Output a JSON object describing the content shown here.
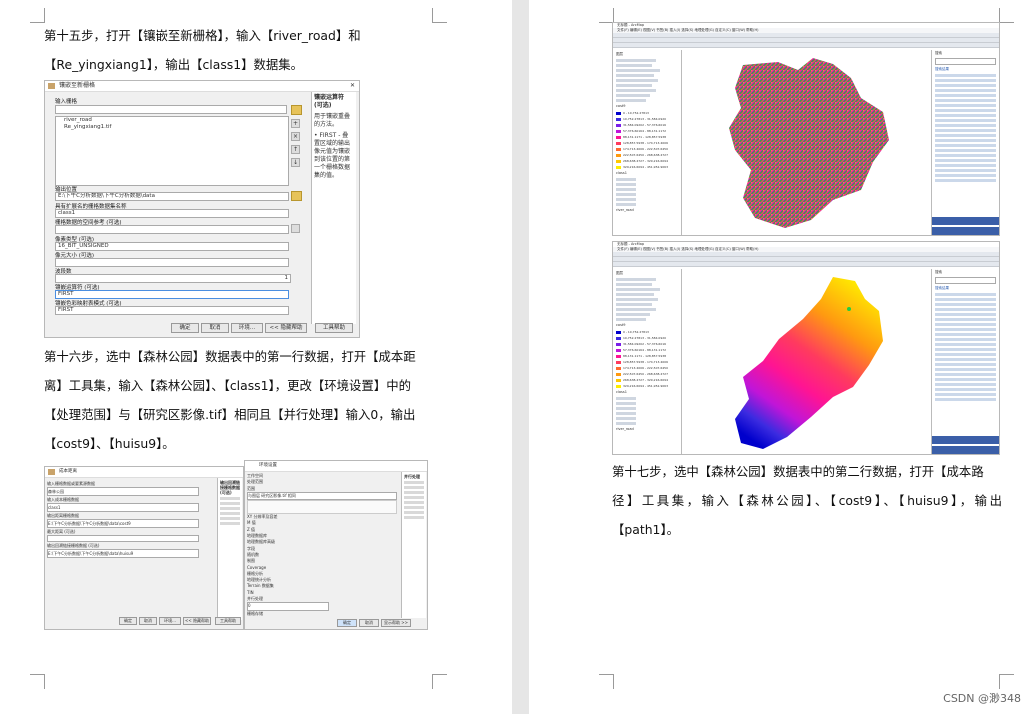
{
  "left_page": {
    "para1": [
      "第十五步，打开【镶嵌至新栅格】，输入【river_road】和",
      "【Re_yingxiang1】，输出【class1】数据集。"
    ],
    "dialog1": {
      "title": "镶嵌至新栅格",
      "input_label": "输入栅格",
      "inputs": [
        "river_road",
        "Re_yingxiang1.tif"
      ],
      "output_loc_label": "输出位置",
      "output_loc_value": "E:\\下午C分析数据\\下午C分析数据\\data",
      "name_label": "具有扩展名的栅格数据集名称",
      "name_value": "class1",
      "sr_label": "栅格数据的空间参考 (可选)",
      "pixel_label": "像素类型 (可选)",
      "pixel_value": "16_BIT_UNSIGNED",
      "cell_label": "像元大小 (可选)",
      "bands_label": "波段数",
      "bands_value": "1",
      "mosaic_label": "镶嵌运算符 (可选)",
      "mosaic_value": "FIRST",
      "colormap_label": "镶嵌色彩映射表模式 (可选)",
      "colormap_value": "FIRST",
      "help_title": "镶嵌运算符 (可选)",
      "help_text": "用于镶嵌重叠的方法。",
      "help_bullet": "• FIRST - 叠置区域的输出像元值为镶嵌到该位置的第一个栅格数据集的值。",
      "buttons": [
        "确定",
        "取消",
        "环境...",
        "<< 隐藏帮助",
        "工具帮助"
      ]
    },
    "para2": [
      "第十六步，选中【森林公园】数据表中的第一行数据，打开【成本距",
      "离】工具集，输入【森林公园】、【class1】，更改【环境设置】中的",
      "【处理范围】与【研究区影像.tif】相同且【并行处理】输入0，输出",
      "【cost9】、【huisu9】。"
    ],
    "dialog2": {
      "title": "成本距离",
      "labels": [
        "输入栅格数据或要素源数据",
        "森林公园",
        "输入成本栅格数据",
        "class1",
        "输出距离栅格数据",
        "E:\\下午C分析数据\\下午C分析数据\\data\\cost9",
        "最大距离 (可选)",
        "输出回溯链接栅格数据 (可选)",
        "E:\\下午C分析数据\\下午C分析数据\\data\\huisu9"
      ],
      "help_title": "输出回溯链接栅格数据 (可选)",
      "buttons": [
        "确定",
        "取消",
        "环境...",
        "<< 隐藏帮助",
        "工具帮助"
      ]
    },
    "dialog3": {
      "title": "环境设置",
      "section_workspace": "工作空间",
      "section_extent": "处理范围",
      "extent_label": "范围",
      "extent_value": "与图层 研究区影像.tif 相同",
      "items": [
        "XY 分辨率及容差",
        "M 值",
        "Z 值",
        "地理数据库",
        "地理数据库高级",
        "字段",
        "随机数",
        "制图",
        "Coverage",
        "栅格分析",
        "地理统计分析",
        "Terrain 数据集",
        "TIN",
        "并行处理",
        "并行处理因子",
        "栅格存储",
        "地理配准"
      ],
      "parallel_value": "0",
      "help_title": "并行处理",
      "buttons": [
        "确定",
        "取消",
        "显示帮助 >>"
      ]
    }
  },
  "right_page": {
    "app_title": "无标题 - ArcMap",
    "menu": [
      "文件(F)",
      "编辑(E)",
      "视图(V)",
      "书签(B)",
      "插入(I)",
      "选择(S)",
      "地理处理(G)",
      "自定义(C)",
      "窗口(W)",
      "帮助(H)"
    ],
    "toc_layers": [
      "图层",
      "river_road",
      "cost9",
      "class1"
    ],
    "legend_values": [
      "0 - 10,752.27813",
      "10,752.27813 - 31,584.0920",
      "31,584.09202 - 57,376.6016",
      "57,376.60164 - 88,131.1172",
      "88,131.1171 - 128,857.5938",
      "128,857.5938 - 174,713.4006",
      "174,713.4006 - 222,507.6450",
      "222,507.6450 - 268,638.4727",
      "268,638.4727 - 329,216.6094",
      "329,216.6094 - 451,952.9063"
    ],
    "search_tab": "搜索",
    "search_results_label": "搜索结果",
    "colors": {
      "legend": [
        "#0000cc",
        "#3b2be0",
        "#7a1fe8",
        "#c015d8",
        "#ff1493",
        "#ff3b5e",
        "#ff6a2c",
        "#ff9a10",
        "#ffc800",
        "#ffee00"
      ]
    },
    "para3": [
      "第十七步，选中【森林公园】数据表中的第二行数据，打开【成本路",
      "径】工具集，输入【森林公园】、【cost9】、【huisu9】，输出【path1】。"
    ]
  },
  "watermark": "CSDN @渺348"
}
